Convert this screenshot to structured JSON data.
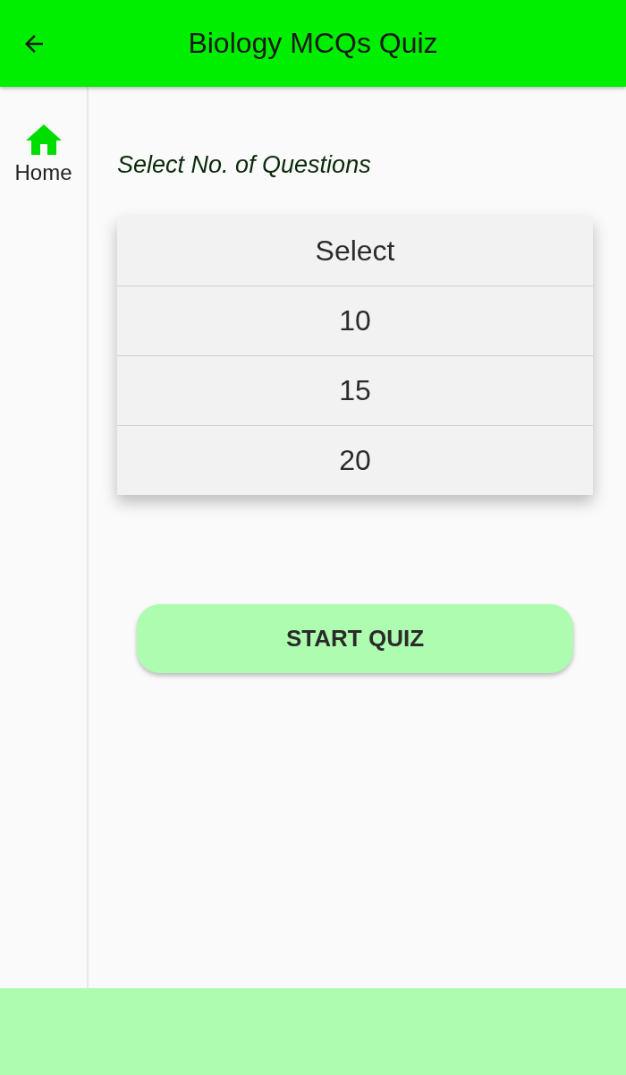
{
  "app_bar": {
    "title": "Biology MCQs Quiz"
  },
  "sidebar": {
    "items": [
      {
        "label": "Home"
      }
    ]
  },
  "prompt": "Select No. of Questions",
  "options": [
    {
      "label": "Select",
      "selected": false
    },
    {
      "label": "10",
      "selected": false
    },
    {
      "label": "15",
      "selected": false
    },
    {
      "label": "20",
      "selected": false
    }
  ],
  "start_button": "START QUIZ"
}
